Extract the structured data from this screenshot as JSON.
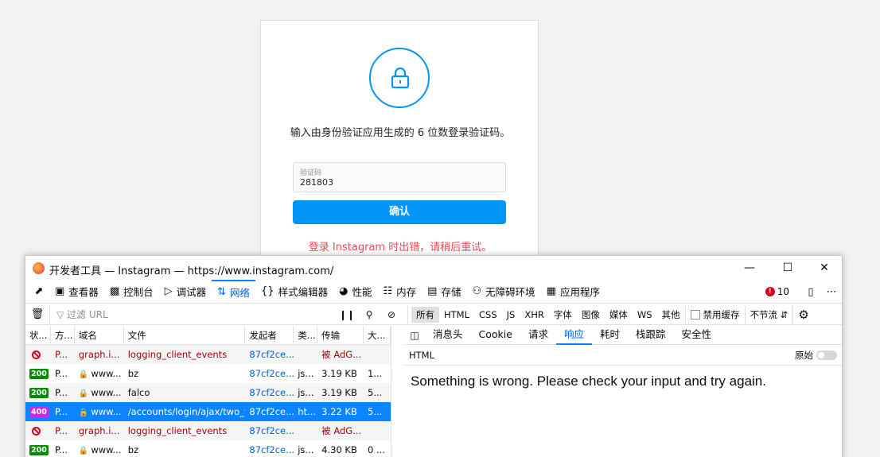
{
  "instagram": {
    "description": "输入由身份验证应用生成的 6 位数登录验证码。",
    "code_label": "验证码",
    "code_value": "281803",
    "confirm_label": "确认",
    "error": "登录 Instagram 时出错，请稍后重试。"
  },
  "devtools": {
    "title": "开发者工具 — Instagram — https://www.instagram.com/",
    "tabs": [
      {
        "label": "查看器",
        "icon": "inspector-icon"
      },
      {
        "label": "控制台",
        "icon": "console-icon"
      },
      {
        "label": "调试器",
        "icon": "debugger-icon"
      },
      {
        "label": "网络",
        "icon": "network-icon"
      },
      {
        "label": "样式编辑器",
        "icon": "style-editor-icon"
      },
      {
        "label": "性能",
        "icon": "performance-icon"
      },
      {
        "label": "内存",
        "icon": "memory-icon"
      },
      {
        "label": "存储",
        "icon": "storage-icon"
      },
      {
        "label": "无障碍环境",
        "icon": "accessibility-icon"
      },
      {
        "label": "应用程序",
        "icon": "application-icon"
      }
    ],
    "error_count": "10",
    "filter_placeholder": "过滤 URL",
    "filter_types": [
      "所有",
      "HTML",
      "CSS",
      "JS",
      "XHR",
      "字体",
      "图像",
      "媒体",
      "WS",
      "其他"
    ],
    "disable_cache_label": "禁用缓存",
    "throttle_label": "不节流",
    "columns": [
      "状...",
      "方...",
      "域名",
      "文件",
      "发起者",
      "类...",
      "传输",
      "大..."
    ],
    "rows": [
      {
        "status": "blocked",
        "method": "P...",
        "domain": "graph.i...",
        "file": "logging_client_events",
        "initiator": "87cf2ce...",
        "type": "",
        "transferred": "被 AdG...",
        "size": "",
        "secure": false,
        "red": true
      },
      {
        "status": "200",
        "method": "P...",
        "domain": "www...",
        "file": "bz",
        "initiator": "87cf2ce...",
        "type": "js...",
        "transferred": "3.19 KB",
        "size": "1...",
        "secure": true,
        "red": false
      },
      {
        "status": "200",
        "method": "P...",
        "domain": "www...",
        "file": "falco",
        "initiator": "87cf2ce...",
        "type": "js...",
        "transferred": "3.19 KB",
        "size": "5...",
        "secure": true,
        "red": false
      },
      {
        "status": "400",
        "method": "P...",
        "domain": "www...",
        "file": "/accounts/login/ajax/two_fa",
        "initiator": "87cf2ce...",
        "type": "ht...",
        "transferred": "3.22 KB",
        "size": "5...",
        "secure": true,
        "red": false,
        "selected": true
      },
      {
        "status": "blocked",
        "method": "P...",
        "domain": "graph.i...",
        "file": "logging_client_events",
        "initiator": "87cf2ce...",
        "type": "",
        "transferred": "被 AdG...",
        "size": "",
        "secure": false,
        "red": true
      },
      {
        "status": "200",
        "method": "P...",
        "domain": "www...",
        "file": "bz",
        "initiator": "87cf2ce...",
        "type": "js...",
        "transferred": "4.30 KB",
        "size": "0 ...",
        "secure": true,
        "red": false
      }
    ],
    "detail_tabs": [
      "消息头",
      "Cookie",
      "请求",
      "响应",
      "耗时",
      "栈跟踪",
      "安全性"
    ],
    "active_detail_tab": "响应",
    "response_type": "HTML",
    "raw_label": "原始",
    "response_body": "Something is wrong. Please check your input and try again."
  }
}
